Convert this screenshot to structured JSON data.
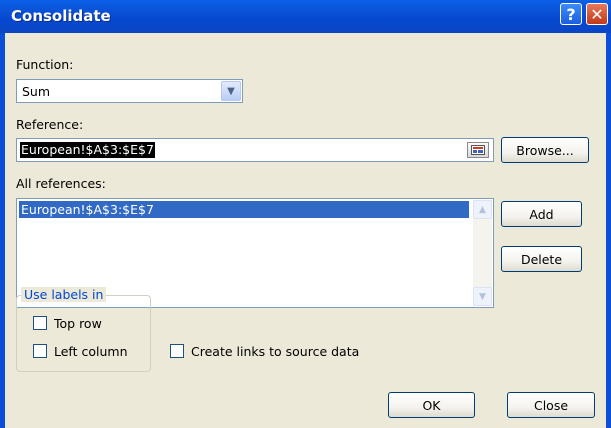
{
  "window": {
    "title": "Consolidate",
    "help_glyph": "?",
    "close_glyph": "✕"
  },
  "function": {
    "label": "Function:",
    "value": "Sum"
  },
  "reference": {
    "label": "Reference:",
    "value": "European!$A$3:$E$7"
  },
  "all_references": {
    "label": "All references:",
    "items": [
      "European!$A$3:$E$7"
    ]
  },
  "buttons": {
    "browse": "Browse...",
    "add": "Add",
    "delete": "Delete",
    "ok": "OK",
    "close": "Close"
  },
  "use_labels": {
    "title": "Use labels in",
    "top_row": "Top row",
    "left_column": "Left column",
    "top_row_checked": false,
    "left_column_checked": false
  },
  "create_links": {
    "label": "Create links to source data",
    "checked": false
  },
  "colors": {
    "titlebar": "#0a4fd6",
    "dialog_bg": "#ece9d8",
    "selection": "#316ac5",
    "group_title": "#0046d5"
  }
}
